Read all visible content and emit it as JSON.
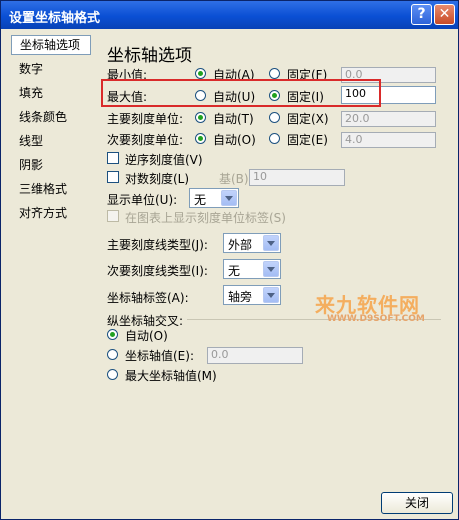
{
  "window": {
    "title": "设置坐标轴格式",
    "help_label": "?",
    "close_label": "✕"
  },
  "sidebar": {
    "items": [
      {
        "label": "坐标轴选项",
        "selected": true
      },
      {
        "label": "数字"
      },
      {
        "label": "填充"
      },
      {
        "label": "线条颜色"
      },
      {
        "label": "线型"
      },
      {
        "label": "阴影"
      },
      {
        "label": "三维格式"
      },
      {
        "label": "对齐方式"
      }
    ]
  },
  "axis_options": {
    "section_title": "坐标轴选项",
    "min": {
      "label": "最小值:",
      "auto": "自动(A)",
      "fixed": "固定(F)",
      "value": "0.0",
      "selected": "auto"
    },
    "max": {
      "label": "最大值:",
      "auto": "自动(U)",
      "fixed": "固定(I)",
      "value": "100",
      "selected": "fixed"
    },
    "major": {
      "label": "主要刻度单位:",
      "auto": "自动(T)",
      "fixed": "固定(X)",
      "value": "20.0",
      "selected": "auto"
    },
    "minor": {
      "label": "次要刻度单位:",
      "auto": "自动(O)",
      "fixed": "固定(E)",
      "value": "4.0",
      "selected": "auto"
    },
    "reverse_label": "逆序刻度值(V)",
    "log_label": "对数刻度(L)",
    "base_label": "基(B):",
    "base_value": "10",
    "display_units_label": "显示单位(U):",
    "display_units_value": "无",
    "show_units_label": "在图表上显示刻度单位标签(S)",
    "major_tick_label": "主要刻度线类型(J):",
    "major_tick_value": "外部",
    "minor_tick_label": "次要刻度线类型(I):",
    "minor_tick_value": "无",
    "axis_labels_label": "坐标轴标签(A):",
    "axis_labels_value": "轴旁",
    "cross_title": "纵坐标轴交叉:",
    "cross_auto": "自动(O)",
    "cross_value_label": "坐标轴值(E):",
    "cross_value": "0.0",
    "cross_max": "最大坐标轴值(M)"
  },
  "watermark": {
    "text": "来九软件网",
    "sub": "WWW.D9SOFT.COM"
  },
  "footer": {
    "close_button": "关闭"
  }
}
